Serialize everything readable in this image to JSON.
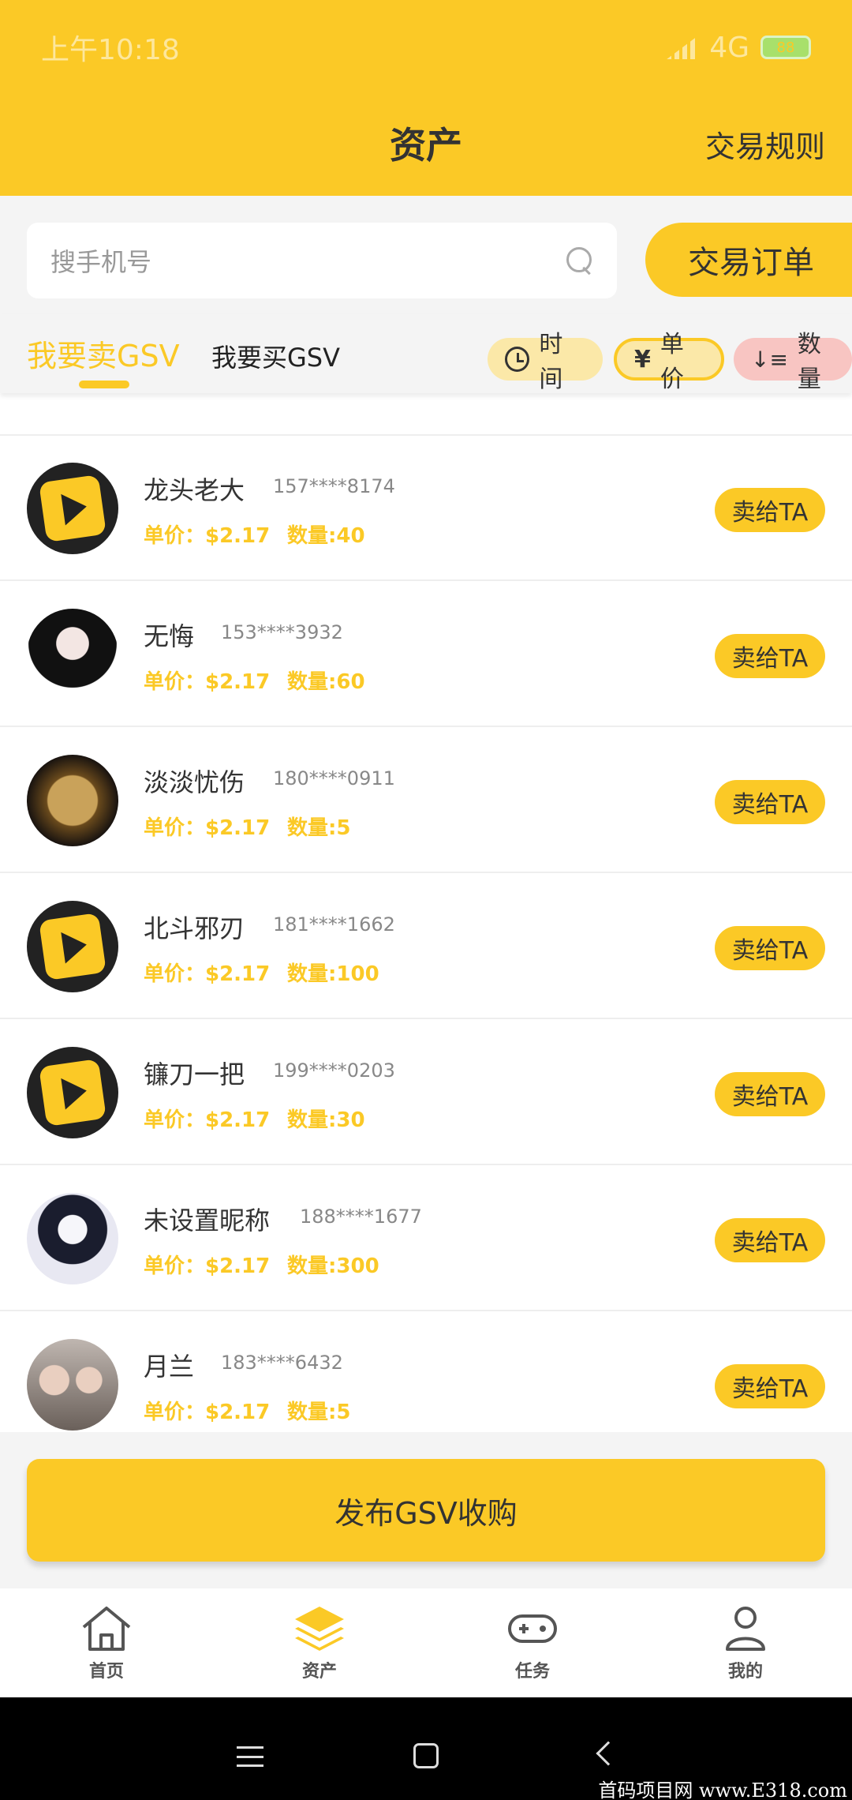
{
  "status_bar": {
    "time": "上午10:18",
    "network": "4G",
    "battery": "88"
  },
  "header": {
    "title": "资产",
    "rules_link": "交易规则"
  },
  "search": {
    "placeholder": "搜手机号",
    "orders_button": "交易订单"
  },
  "tabs": {
    "sell": "我要卖GSV",
    "buy": "我要买GSV"
  },
  "sort_chips": {
    "time": "时间",
    "price": "单价",
    "quantity": "数量"
  },
  "listings": [
    {
      "name": "龙头老大",
      "phone": "157****8174",
      "price": "单价：$2.17",
      "quantity": "数量:40",
      "action": "卖给TA",
      "avatar": "play-logo"
    },
    {
      "name": "无悔",
      "phone": "153****3932",
      "price": "单价：$2.17",
      "quantity": "数量:60",
      "action": "卖给TA",
      "avatar": "girl-portrait"
    },
    {
      "name": "淡淡忧伤",
      "phone": "180****0911",
      "price": "单价：$2.17",
      "quantity": "数量:5",
      "action": "卖给TA",
      "avatar": "gold-coin"
    },
    {
      "name": "北斗邪刃",
      "phone": "181****1662",
      "price": "单价：$2.17",
      "quantity": "数量:100",
      "action": "卖给TA",
      "avatar": "play-logo"
    },
    {
      "name": "镰刀一把",
      "phone": "199****0203",
      "price": "单价：$2.17",
      "quantity": "数量:30",
      "action": "卖给TA",
      "avatar": "play-logo"
    },
    {
      "name": "未设置昵称",
      "phone": "188****1677",
      "price": "单价：$2.17",
      "quantity": "数量:300",
      "action": "卖给TA",
      "avatar": "boy-portrait"
    },
    {
      "name": "月兰",
      "phone": "183****6432",
      "price": "单价：$2.17",
      "quantity": "数量:5",
      "action": "卖给TA",
      "avatar": "group-photo"
    }
  ],
  "publish_button": "发布GSV收购",
  "bottom_nav": [
    {
      "label": "首页",
      "icon": "home-icon"
    },
    {
      "label": "资产",
      "icon": "layers-icon"
    },
    {
      "label": "任务",
      "icon": "gamepad-icon"
    },
    {
      "label": "我的",
      "icon": "user-icon"
    }
  ],
  "watermark": "首码项目网 www.E318.com",
  "colors": {
    "accent": "#fbc926",
    "background": "#f4f4f4",
    "text": "#333333"
  }
}
